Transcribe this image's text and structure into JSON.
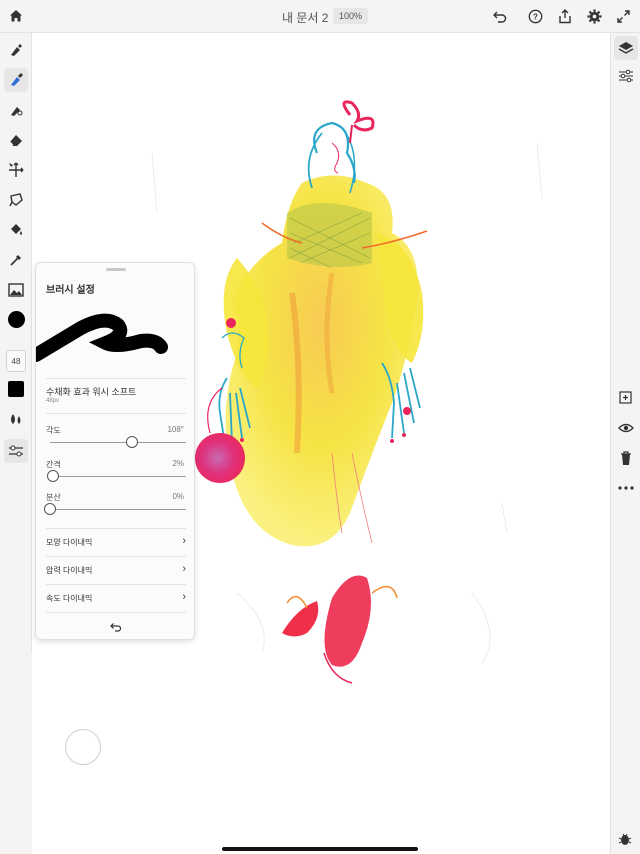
{
  "topbar": {
    "document_title": "내 문서 2",
    "zoom": "100%",
    "icons": [
      "home-icon",
      "undo-icon",
      "help-icon",
      "share-icon",
      "settings-icon",
      "fullscreen-icon"
    ]
  },
  "left_toolbar": {
    "tools": [
      "pixel-brush-icon",
      "paint-brush-icon",
      "eraser-brush-icon",
      "eraser-icon",
      "move-icon",
      "lasso-icon",
      "fill-icon",
      "eyedropper-icon",
      "image-icon"
    ],
    "active_tool": "paint-brush-icon",
    "current_color": "#000000",
    "brush_size": "48"
  },
  "brush_panel": {
    "title": "브러시 설정",
    "brush_name": "수채화 효과 워시 소프트",
    "brush_size": "48px",
    "sliders": [
      {
        "label": "각도",
        "value_text": "108°",
        "value": 0.6
      },
      {
        "label": "간격",
        "value_text": "2%",
        "value": 0.02
      },
      {
        "label": "분산",
        "value_text": "0%",
        "value": 0.0
      }
    ],
    "menu": [
      {
        "label": "모양 다이내믹",
        "chevron": "›"
      },
      {
        "label": "압력 다이내믹",
        "chevron": "›"
      },
      {
        "label": "속도 다이내믹",
        "chevron": "›"
      }
    ]
  },
  "right_toolbar": {
    "icons": [
      "layers-icon",
      "adjustments-icon",
      "add-layer-icon",
      "visibility-icon",
      "delete-icon",
      "more-icon"
    ]
  },
  "colors": {
    "dress_yellow": "#f5e43a",
    "accent_pink": "#e8265c",
    "accent_cyan": "#2aa7c9",
    "accent_orange": "#f08a2c"
  }
}
